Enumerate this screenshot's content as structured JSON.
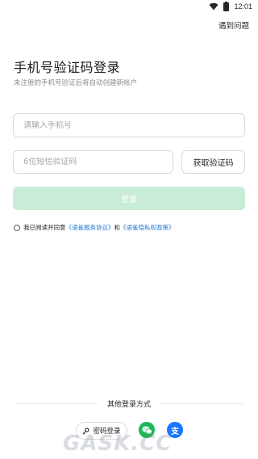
{
  "status_bar": {
    "time": "12:01"
  },
  "header": {
    "help_link": "遇到问题"
  },
  "main": {
    "title": "手机号验证码登录",
    "subtitle": "未注册的手机号验证后将自动创建新帐户",
    "phone_placeholder": "请输入手机号",
    "code_placeholder": "6位短信验证码",
    "get_code_label": "获取验证码",
    "login_label": "登录",
    "login_button_color": "#c8ecd7"
  },
  "agreement": {
    "prefix": "我已阅读并同意",
    "service_link": "《语雀服务协议》",
    "and": "和",
    "privacy_link": "《语雀隐私权政策》",
    "link_color": "#1f78d1"
  },
  "other_login": {
    "label": "其他登录方式",
    "password_login_label": "密码登录",
    "password_icon": "key-icon",
    "wechat_icon": "wechat-icon",
    "wechat_color": "#19b955",
    "alipay_glyph": "支",
    "alipay_color": "#1677ff"
  },
  "watermark": "GASK.CC"
}
